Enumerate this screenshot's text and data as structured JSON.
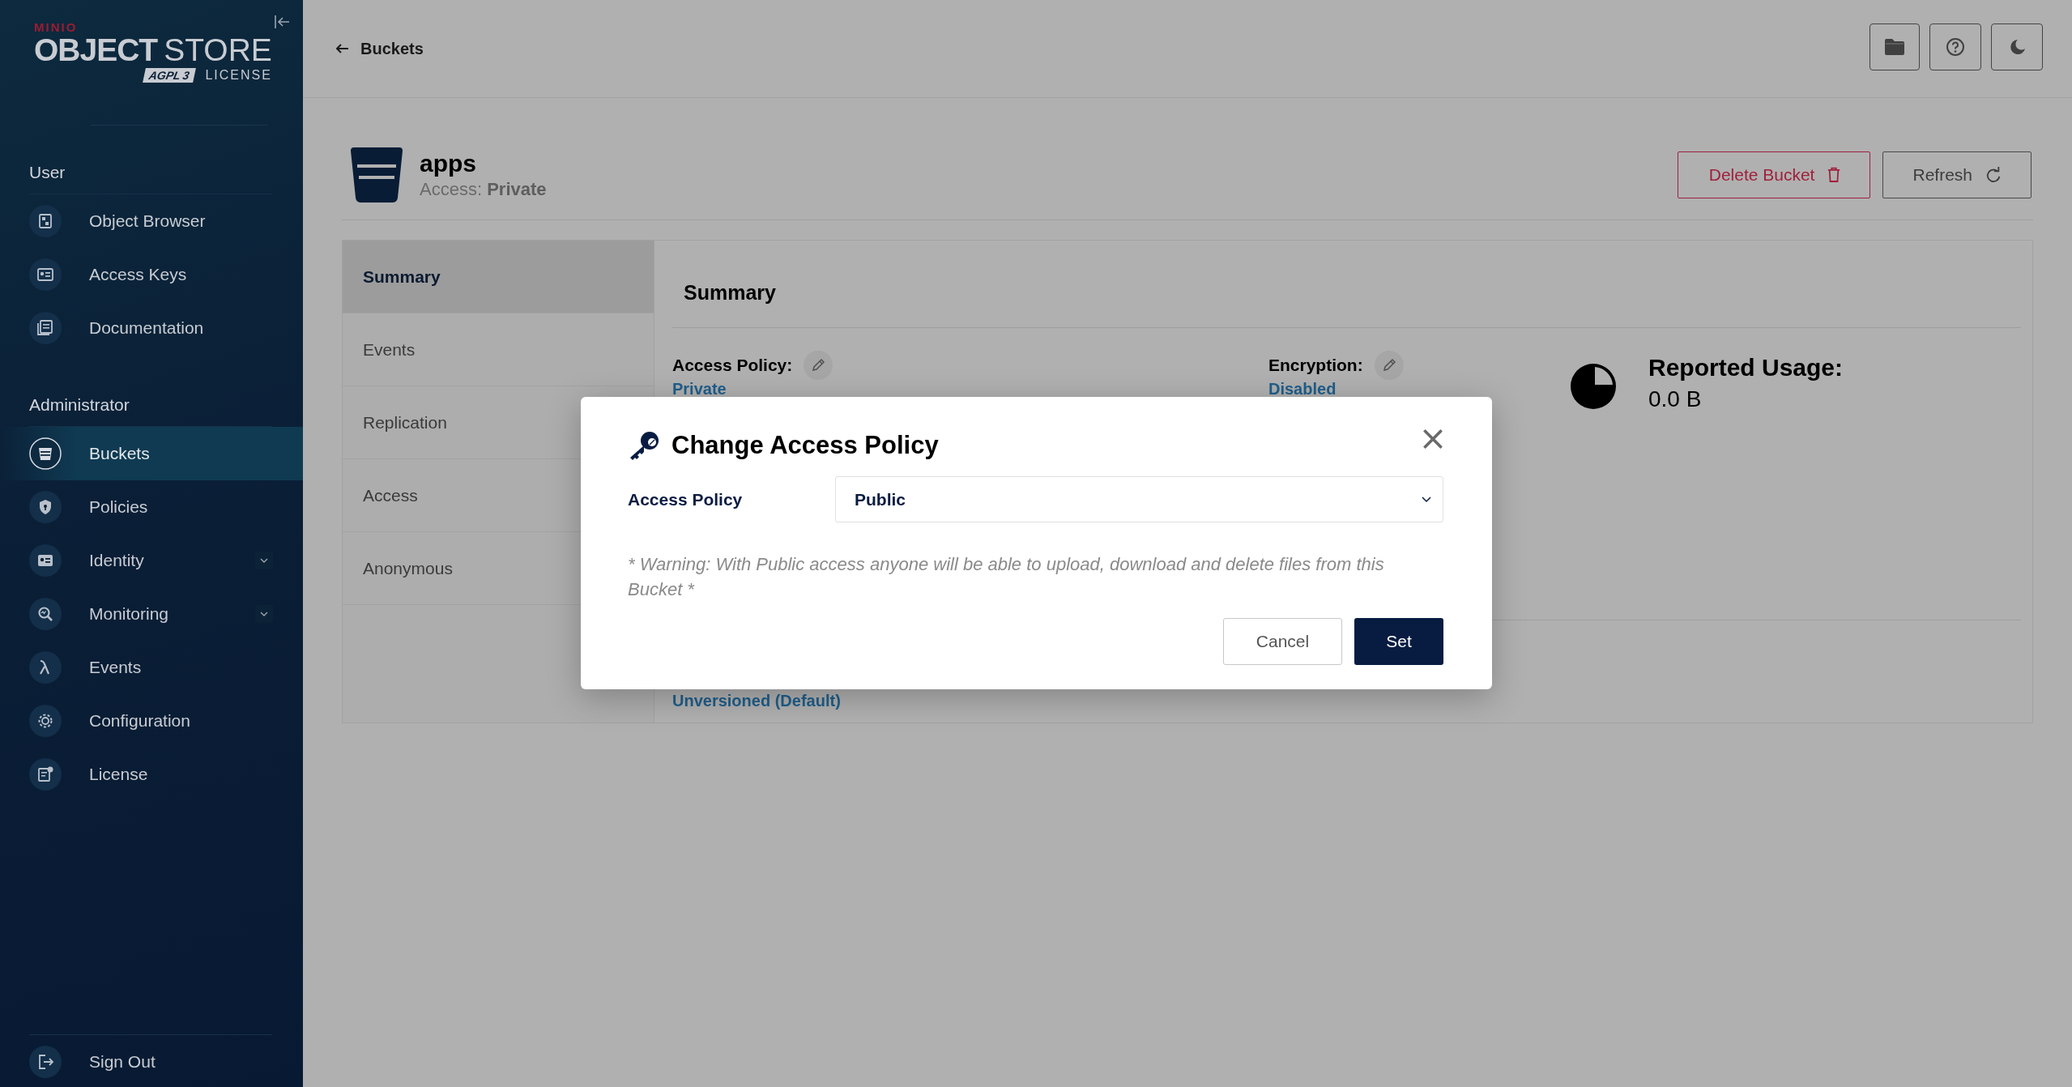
{
  "sidebar": {
    "logo": {
      "brand": "MINIO",
      "product_bold": "OBJECT",
      "product_light": "STORE",
      "badge": "AGPL",
      "badge_version": "3",
      "license": "LICENSE"
    },
    "sections": [
      {
        "title": "User",
        "items": [
          {
            "label": "Object Browser",
            "kind": "link",
            "selected": false
          },
          {
            "label": "Access Keys",
            "kind": "link",
            "selected": false
          },
          {
            "label": "Documentation",
            "kind": "link",
            "selected": false
          }
        ]
      },
      {
        "title": "Administrator",
        "items": [
          {
            "label": "Buckets",
            "kind": "link",
            "selected": true
          },
          {
            "label": "Policies",
            "kind": "link",
            "selected": false
          },
          {
            "label": "Identity",
            "kind": "group",
            "expanded": false,
            "selected": false
          },
          {
            "label": "Monitoring",
            "kind": "group",
            "expanded": false,
            "selected": false
          },
          {
            "label": "Events",
            "kind": "link",
            "selected": false
          },
          {
            "label": "Configuration",
            "kind": "link",
            "selected": false
          },
          {
            "label": "License",
            "kind": "link",
            "selected": false
          }
        ]
      }
    ],
    "sign_out": "Sign Out"
  },
  "header": {
    "back_label": "Buckets"
  },
  "bucket": {
    "name": "apps",
    "access_label": "Access:",
    "access_value": "Private",
    "buttons": [
      {
        "label": "Delete Bucket",
        "kind": "danger"
      },
      {
        "label": "Refresh",
        "kind": "default"
      }
    ]
  },
  "tabs": [
    {
      "label": "Summary",
      "selected": true
    },
    {
      "label": "Events",
      "selected": false
    },
    {
      "label": "Replication",
      "selected": false
    },
    {
      "label": "Access",
      "selected": false
    },
    {
      "label": "Anonymous",
      "selected": false
    }
  ],
  "summary": {
    "title": "Summary",
    "access_policy": {
      "label": "Access Policy:",
      "value": "Private"
    },
    "encryption": {
      "label": "Encryption:",
      "value": "Disabled"
    },
    "usage": {
      "label": "Reported Usage:",
      "value": "0.0 B"
    },
    "versioning": {
      "value": "Unversioned (Default)"
    }
  },
  "modal": {
    "title": "Change Access Policy",
    "field_label": "Access Policy",
    "field_value": "Public",
    "warning": "* Warning: With Public access anyone will be able to upload, download and delete files from this Bucket *",
    "buttons": [
      {
        "label": "Cancel",
        "kind": "secondary"
      },
      {
        "label": "Set",
        "kind": "primary"
      }
    ]
  }
}
